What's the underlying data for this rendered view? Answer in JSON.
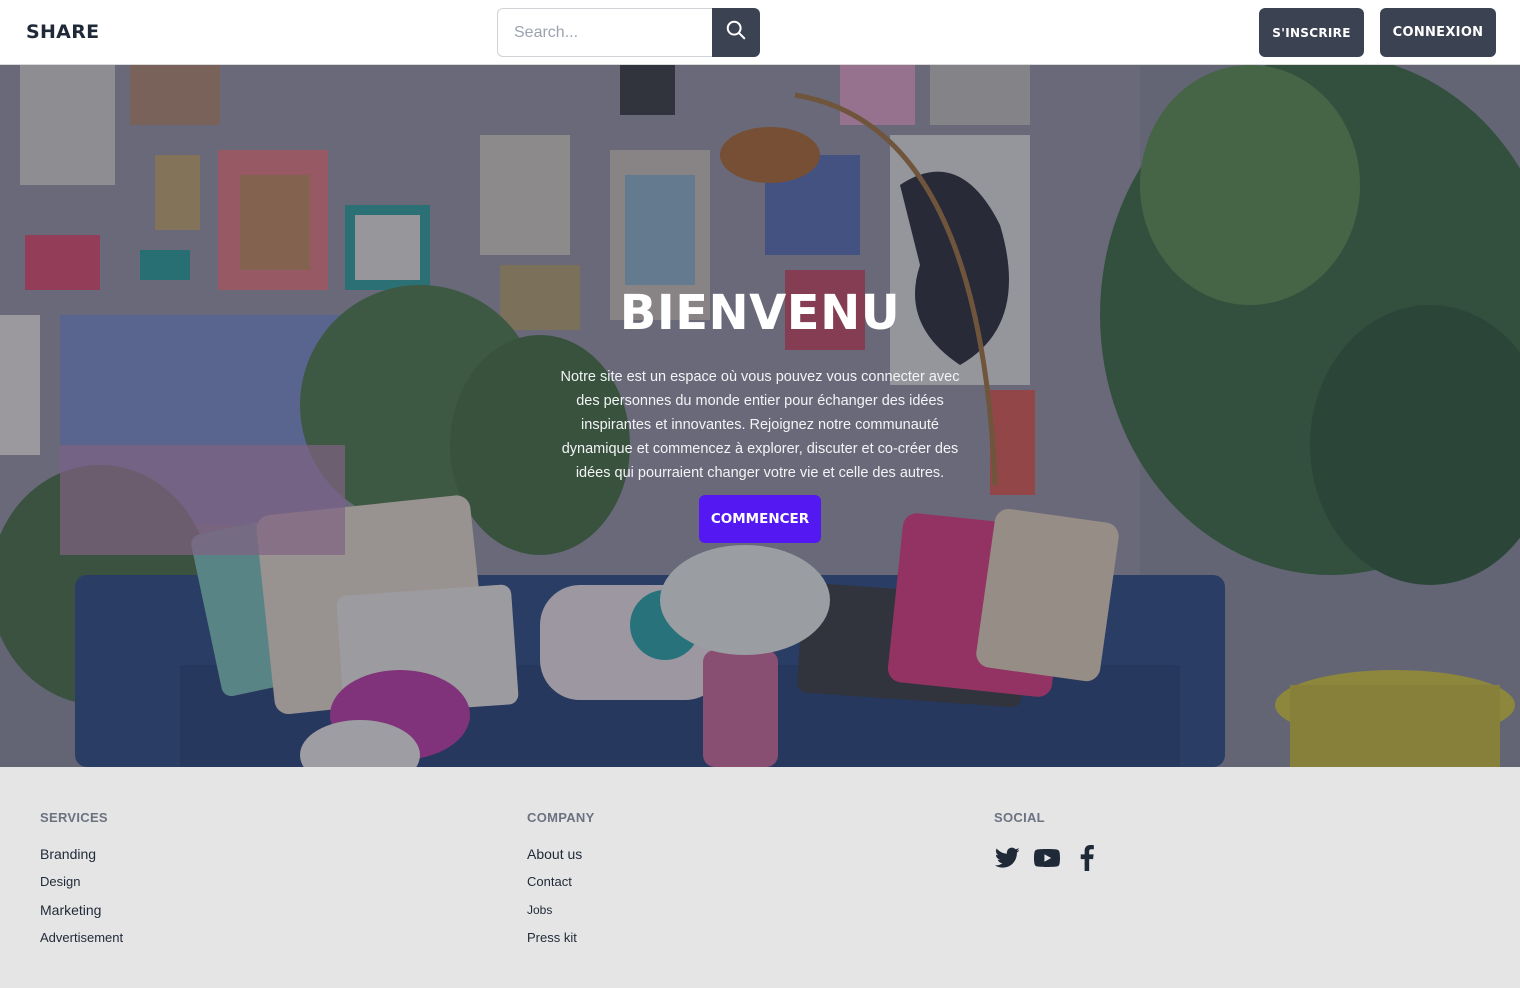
{
  "navbar": {
    "brand": "SHARE",
    "search": {
      "placeholder": "Search..."
    },
    "signup_label": "S'INSCRIRE",
    "login_label": "CONNEXION"
  },
  "hero": {
    "title": "BIENVENU",
    "text": "Notre site est un espace où vous pouvez vous connecter avec des personnes du monde entier pour échanger des idées inspirantes et innovantes. Rejoignez notre communauté dynamique et commencez à explorer, discuter et co-créer des idées qui pourraient changer votre vie et celle des autres.",
    "cta_label": "COMMENCER"
  },
  "footer": {
    "services": {
      "heading": "SERVICES",
      "items": [
        "Branding",
        "Design",
        "Marketing",
        "Advertisement"
      ]
    },
    "company": {
      "heading": "COMPANY",
      "items": [
        "About us",
        "Contact",
        "Jobs",
        "Press kit"
      ]
    },
    "social": {
      "heading": "SOCIAL",
      "icons": [
        "twitter-icon",
        "youtube-icon",
        "facebook-icon"
      ]
    }
  },
  "colors": {
    "nav_button": "#3b4252",
    "cta": "#5418f2",
    "footer_bg": "#e5e5e5"
  }
}
